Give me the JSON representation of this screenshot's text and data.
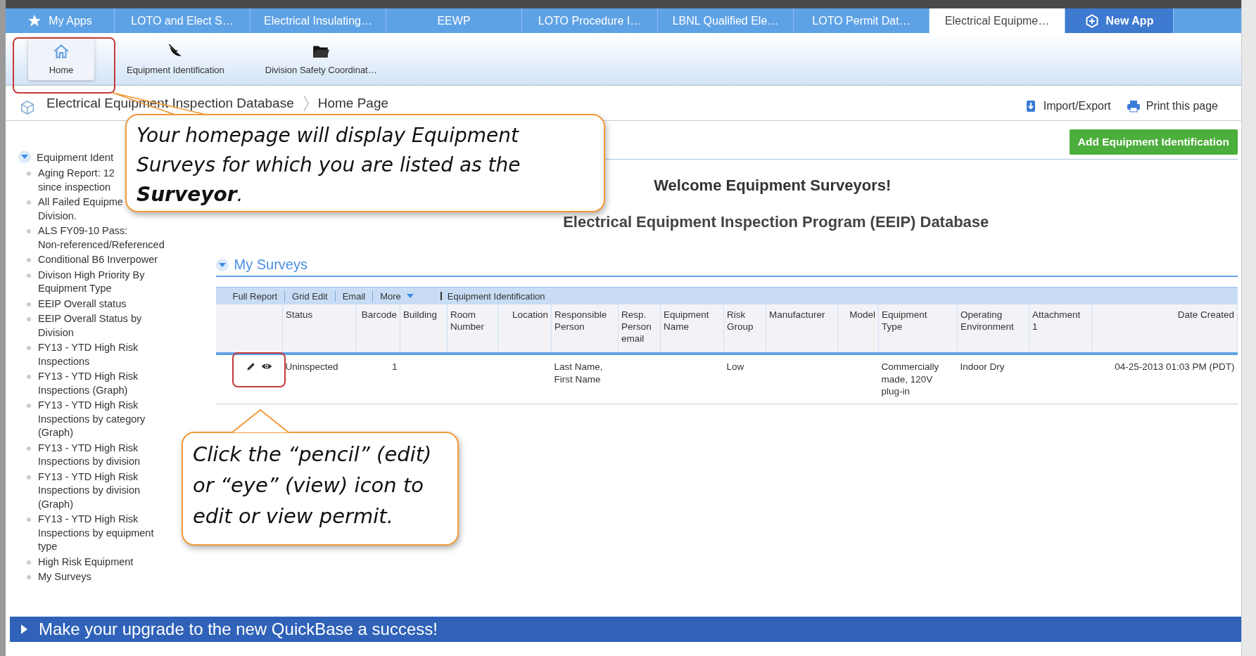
{
  "app_tabs": [
    {
      "label": "My Apps",
      "kind": "star",
      "selected": false
    },
    {
      "label": "LOTO and Elect S…",
      "kind": "plain",
      "selected": false
    },
    {
      "label": "Electrical Insulating…",
      "kind": "plain",
      "selected": false
    },
    {
      "label": "EEWP",
      "kind": "plain",
      "selected": false
    },
    {
      "label": "LOTO Procedure I…",
      "kind": "plain",
      "selected": false
    },
    {
      "label": "LBNL Qualified Ele…",
      "kind": "plain",
      "selected": false
    },
    {
      "label": "LOTO Permit Dat…",
      "kind": "plain",
      "selected": false
    },
    {
      "label": "Electrical Equipme…",
      "kind": "plain",
      "selected": true
    },
    {
      "label": "New App",
      "kind": "new",
      "selected": false
    }
  ],
  "toolbar": [
    {
      "label": "Home",
      "selected": true
    },
    {
      "label": "Equipment Identification",
      "selected": false
    },
    {
      "label": "Division Safety Coordinat…",
      "selected": false
    }
  ],
  "breadcrumb": [
    "Electrical Equipment Inspection Database",
    "Home Page"
  ],
  "page_actions": [
    "Import/Export",
    "Print this page"
  ],
  "sidebar": {
    "heading": "Equipment Ident",
    "expanded": true,
    "items": [
      "Aging Report: 12\nsince inspection",
      "All Failed Equipme\nDivision.",
      "ALS FY09-10 Pass:\nNon-referenced/Referenced",
      "Conditional B6 Inverpower",
      "Divison High Priority By\nEquipment Type",
      "EEIP Overall status",
      "EEIP Overall Status by\nDivision",
      "FY13 - YTD High Risk\nInspections",
      "FY13 - YTD High Risk\nInspections (Graph)",
      "FY13 - YTD High Risk\nInspections by category\n(Graph)",
      "FY13 - YTD High Risk\nInspections by division",
      "FY13 - YTD High Risk\nInspections by division\n(Graph)",
      "FY13 - YTD High Risk\nInspections by equipment\ntype",
      "High Risk Equipment",
      "My Surveys"
    ]
  },
  "add_button": "Add Equipment Identification",
  "welcome": "Welcome Equipment Surveyors!",
  "subtitle": "Electrical Equipment Inspection Program (EEIP) Database",
  "surveys": {
    "title": "My Surveys",
    "expanded": true,
    "actions": [
      "Full Report",
      "Grid Edit",
      "Email",
      "More"
    ],
    "table_name": "Equipment Identification",
    "columns": [
      "Status",
      "Barcode",
      "Building",
      "Room\nNumber",
      "Location",
      "Responsible\nPerson",
      "Resp.\nPerson\nemail",
      "Equipment\nName",
      "Risk\nGroup",
      "Manufacturer",
      "Model",
      "Equipment\nType",
      "Operating\nEnvironment",
      "Attachment\n1",
      "Date Created"
    ],
    "rows": [
      [
        "Uninspected",
        "1",
        "",
        "",
        "",
        "Last Name,\nFirst Name",
        "",
        "",
        "Low",
        "",
        "",
        "Commercially\nmade, 120V\nplug-in",
        "Indoor Dry",
        "",
        "04-25-2013 01:03 PM (PDT)"
      ]
    ]
  },
  "banner": "Make your upgrade to the new QuickBase a success!",
  "callouts": [
    {
      "text": "Your homepage will display Equipment Surveys for which you are listed as the **Surveyor**."
    },
    {
      "text": "Click the “pencil” (edit) or “eye” (view) icon to edit or view permit."
    }
  ]
}
